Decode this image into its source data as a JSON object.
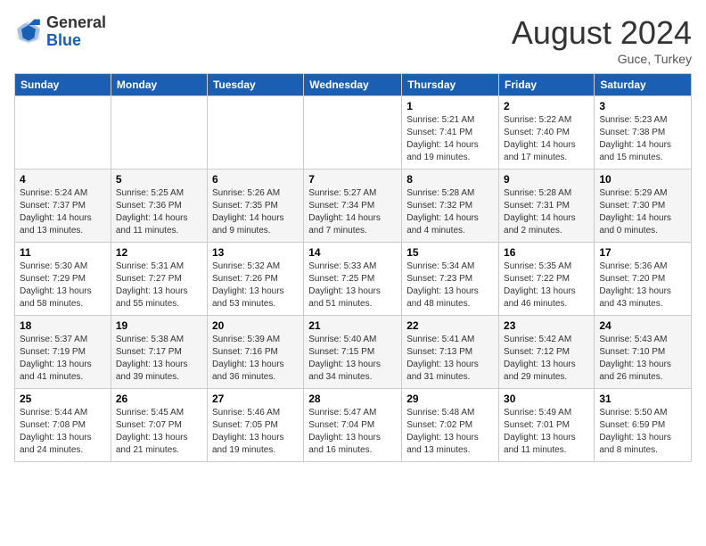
{
  "header": {
    "logo_line1": "General",
    "logo_line2": "Blue",
    "month": "August 2024",
    "location": "Guce, Turkey"
  },
  "weekdays": [
    "Sunday",
    "Monday",
    "Tuesday",
    "Wednesday",
    "Thursday",
    "Friday",
    "Saturday"
  ],
  "weeks": [
    [
      {
        "day": "",
        "info": ""
      },
      {
        "day": "",
        "info": ""
      },
      {
        "day": "",
        "info": ""
      },
      {
        "day": "",
        "info": ""
      },
      {
        "day": "1",
        "info": "Sunrise: 5:21 AM\nSunset: 7:41 PM\nDaylight: 14 hours\nand 19 minutes."
      },
      {
        "day": "2",
        "info": "Sunrise: 5:22 AM\nSunset: 7:40 PM\nDaylight: 14 hours\nand 17 minutes."
      },
      {
        "day": "3",
        "info": "Sunrise: 5:23 AM\nSunset: 7:38 PM\nDaylight: 14 hours\nand 15 minutes."
      }
    ],
    [
      {
        "day": "4",
        "info": "Sunrise: 5:24 AM\nSunset: 7:37 PM\nDaylight: 14 hours\nand 13 minutes."
      },
      {
        "day": "5",
        "info": "Sunrise: 5:25 AM\nSunset: 7:36 PM\nDaylight: 14 hours\nand 11 minutes."
      },
      {
        "day": "6",
        "info": "Sunrise: 5:26 AM\nSunset: 7:35 PM\nDaylight: 14 hours\nand 9 minutes."
      },
      {
        "day": "7",
        "info": "Sunrise: 5:27 AM\nSunset: 7:34 PM\nDaylight: 14 hours\nand 7 minutes."
      },
      {
        "day": "8",
        "info": "Sunrise: 5:28 AM\nSunset: 7:32 PM\nDaylight: 14 hours\nand 4 minutes."
      },
      {
        "day": "9",
        "info": "Sunrise: 5:28 AM\nSunset: 7:31 PM\nDaylight: 14 hours\nand 2 minutes."
      },
      {
        "day": "10",
        "info": "Sunrise: 5:29 AM\nSunset: 7:30 PM\nDaylight: 14 hours\nand 0 minutes."
      }
    ],
    [
      {
        "day": "11",
        "info": "Sunrise: 5:30 AM\nSunset: 7:29 PM\nDaylight: 13 hours\nand 58 minutes."
      },
      {
        "day": "12",
        "info": "Sunrise: 5:31 AM\nSunset: 7:27 PM\nDaylight: 13 hours\nand 55 minutes."
      },
      {
        "day": "13",
        "info": "Sunrise: 5:32 AM\nSunset: 7:26 PM\nDaylight: 13 hours\nand 53 minutes."
      },
      {
        "day": "14",
        "info": "Sunrise: 5:33 AM\nSunset: 7:25 PM\nDaylight: 13 hours\nand 51 minutes."
      },
      {
        "day": "15",
        "info": "Sunrise: 5:34 AM\nSunset: 7:23 PM\nDaylight: 13 hours\nand 48 minutes."
      },
      {
        "day": "16",
        "info": "Sunrise: 5:35 AM\nSunset: 7:22 PM\nDaylight: 13 hours\nand 46 minutes."
      },
      {
        "day": "17",
        "info": "Sunrise: 5:36 AM\nSunset: 7:20 PM\nDaylight: 13 hours\nand 43 minutes."
      }
    ],
    [
      {
        "day": "18",
        "info": "Sunrise: 5:37 AM\nSunset: 7:19 PM\nDaylight: 13 hours\nand 41 minutes."
      },
      {
        "day": "19",
        "info": "Sunrise: 5:38 AM\nSunset: 7:17 PM\nDaylight: 13 hours\nand 39 minutes."
      },
      {
        "day": "20",
        "info": "Sunrise: 5:39 AM\nSunset: 7:16 PM\nDaylight: 13 hours\nand 36 minutes."
      },
      {
        "day": "21",
        "info": "Sunrise: 5:40 AM\nSunset: 7:15 PM\nDaylight: 13 hours\nand 34 minutes."
      },
      {
        "day": "22",
        "info": "Sunrise: 5:41 AM\nSunset: 7:13 PM\nDaylight: 13 hours\nand 31 minutes."
      },
      {
        "day": "23",
        "info": "Sunrise: 5:42 AM\nSunset: 7:12 PM\nDaylight: 13 hours\nand 29 minutes."
      },
      {
        "day": "24",
        "info": "Sunrise: 5:43 AM\nSunset: 7:10 PM\nDaylight: 13 hours\nand 26 minutes."
      }
    ],
    [
      {
        "day": "25",
        "info": "Sunrise: 5:44 AM\nSunset: 7:08 PM\nDaylight: 13 hours\nand 24 minutes."
      },
      {
        "day": "26",
        "info": "Sunrise: 5:45 AM\nSunset: 7:07 PM\nDaylight: 13 hours\nand 21 minutes."
      },
      {
        "day": "27",
        "info": "Sunrise: 5:46 AM\nSunset: 7:05 PM\nDaylight: 13 hours\nand 19 minutes."
      },
      {
        "day": "28",
        "info": "Sunrise: 5:47 AM\nSunset: 7:04 PM\nDaylight: 13 hours\nand 16 minutes."
      },
      {
        "day": "29",
        "info": "Sunrise: 5:48 AM\nSunset: 7:02 PM\nDaylight: 13 hours\nand 13 minutes."
      },
      {
        "day": "30",
        "info": "Sunrise: 5:49 AM\nSunset: 7:01 PM\nDaylight: 13 hours\nand 11 minutes."
      },
      {
        "day": "31",
        "info": "Sunrise: 5:50 AM\nSunset: 6:59 PM\nDaylight: 13 hours\nand 8 minutes."
      }
    ]
  ]
}
